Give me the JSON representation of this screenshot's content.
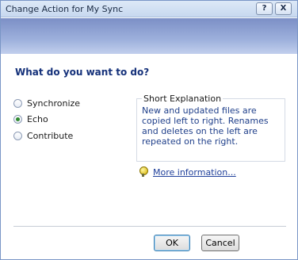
{
  "window": {
    "title": "Change Action for My Sync",
    "help_label": "?",
    "close_label": "X"
  },
  "main": {
    "question": "What do you want to do?",
    "options": [
      {
        "label": "Synchronize",
        "selected": false
      },
      {
        "label": "Echo",
        "selected": true
      },
      {
        "label": "Contribute",
        "selected": false
      }
    ],
    "explanation_title": "Short Explanation",
    "explanation_text": "New and updated files are copied left to right. Renames and deletes on the left are repeated on the right.",
    "more_info_label": "More information..."
  },
  "footer": {
    "ok_label": "OK",
    "cancel_label": "Cancel"
  },
  "icons": {
    "bulb": "lightbulb-icon"
  }
}
